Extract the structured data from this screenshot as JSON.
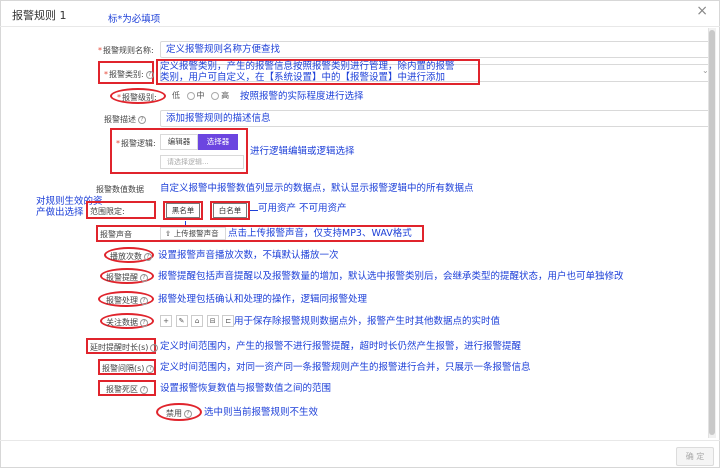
{
  "dialog": {
    "title": "报警规则 1",
    "close_glyph": "×",
    "ok_label": "确 定"
  },
  "annotations": {
    "required_note": "标*为必填项",
    "name_note": "定义报警规则名称方便查找",
    "type_note_line1": "定义报警类别，产生的报警信息按照报警类别进行管理，除内置的报警",
    "type_note_line2": "类别，用户可自定义，在【系统设置】中的【报警设置】中进行添加",
    "level_note": "按照报警的实际程度进行选择",
    "desc_note": "添加报警规则的描述信息",
    "logic_note": "进行逻辑编辑或逻辑选择",
    "datapoint_note": "自定义报警中报警数值列显示的数据点，默认显示报警逻辑中的所有数据点",
    "scope_left_line1": "对规则生效的资",
    "scope_left_line2": "产做出选择",
    "scope_note": "可用资产 不可用资产",
    "sound_note": "点击上传报警声音，仅支持MP3、WAV格式",
    "play_note": "设置报警声音播放次数，不填默认播放一次",
    "remind_note": "报警提醒包括声音提醒以及报警数量的增加，默认选中报警类别后，会继承类型的提醒状态，用户也可单独修改",
    "handle_note": "报警处理包括确认和处理的操作，逻辑同报警处理",
    "focus_note": "用于保存除报警规则数据点外，报警产生时其他数据点的实时值",
    "delay_note": "定义时间范围内，产生的报警不进行报警提醒，超时时长仍然产生报警，进行报警提醒",
    "interval_note": "定义时间范围内，对同一资产同一条报警规则产生的报警进行合并，只展示一条报警信息",
    "deadband_note": "设置报警恢复数值与报警数值之间的范围",
    "disable_note": "选中则当前报警规则不生效"
  },
  "form": {
    "name_label": "报警规则名称:",
    "type_label": "报警类别:",
    "level_label": "报警级别:",
    "level_options": [
      "低",
      "中",
      "高"
    ],
    "desc_label": "报警描述",
    "logic_label": "报警逻辑:",
    "logic_tabs": [
      "编辑器",
      "选择器"
    ],
    "logic_select_placeholder": "请选择逻辑...",
    "datapoint_label": "报警数值数据",
    "scope_label": "范围限定:",
    "blacklist_label": "黑名单",
    "whitelist_label": "白名单",
    "sound_label": "报警声音",
    "upload_label": "上传报警声音",
    "upload_glyph": "⇧",
    "play_label": "播放次数",
    "remind_label": "报警提醒",
    "handle_label": "报警处理",
    "focus_label": "关注数据",
    "toolbar_icons": [
      "+",
      "✎",
      "⌂",
      "⊟",
      "⊏"
    ],
    "delay_label": "延时提醒时长(s)",
    "interval_label": "报警间隔(s)",
    "deadband_label": "报警死区",
    "disable_label": "禁用",
    "help_glyph": "?"
  },
  "colors": {
    "accent_purple": "#6b45e0",
    "annotation_blue": "#1e40d8",
    "annotation_red": "#e0242c"
  }
}
